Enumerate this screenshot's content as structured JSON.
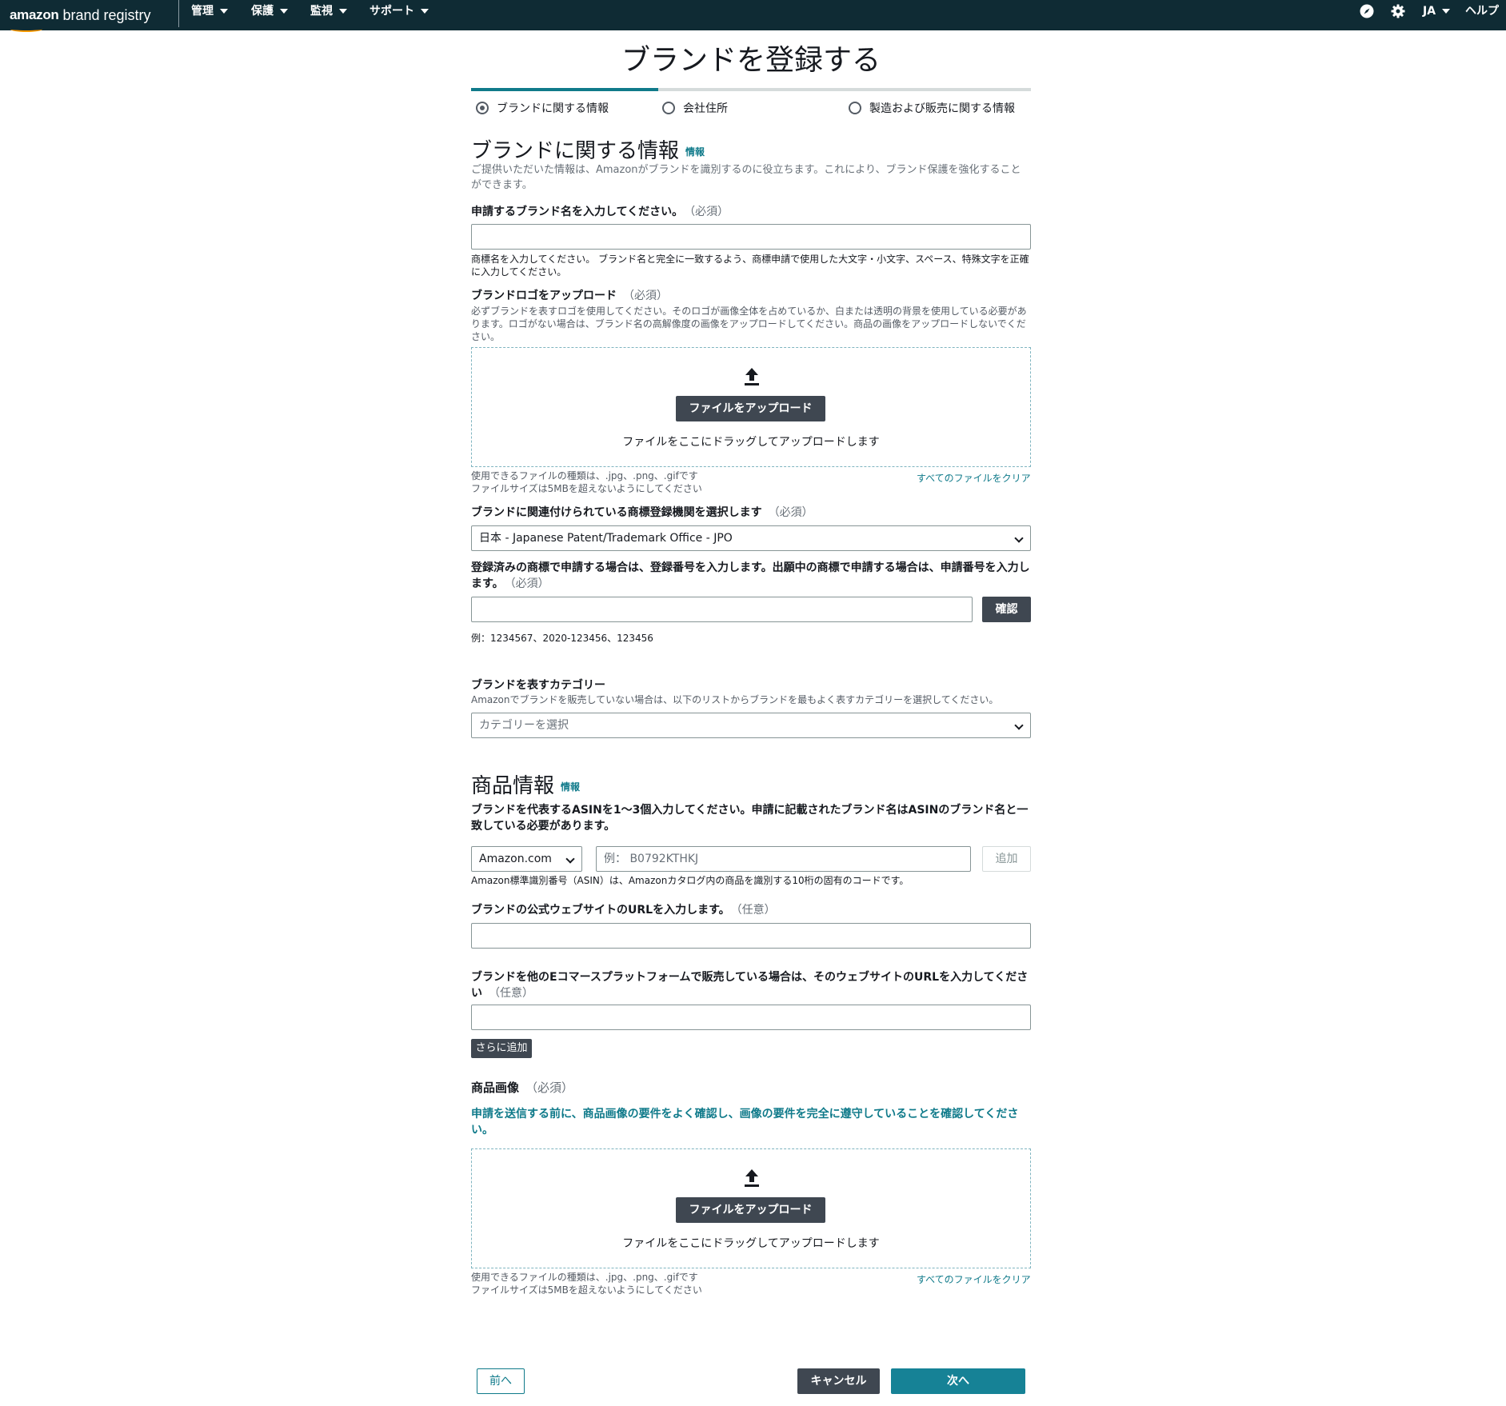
{
  "nav": {
    "logo_amazon": "amazon",
    "logo_rest": "brand registry",
    "menus": [
      "管理",
      "保護",
      "監視",
      "サポート"
    ],
    "icons": [
      "compass-icon",
      "gear-icon"
    ],
    "language": "JA",
    "help": "ヘルプ",
    "background": "#0f2b34"
  },
  "page": {
    "title": "ブランドを登録する",
    "steps": [
      "ブランドに関する情報",
      "会社住所",
      "製造および販売に関する情報"
    ],
    "active_step": 0,
    "accent_color": "#0f7a8a"
  },
  "brand_section": {
    "heading": "ブランドに関する情報",
    "info_link": "情報",
    "description": "ご提供いただいた情報は、Amazonがブランドを識別するのに役立ちます。これにより、ブランド保護を強化することができます。",
    "brand_name_label": "申請するブランド名を入力してください。",
    "brand_name_required": "（必須）",
    "brand_name_value": "",
    "brand_name_help": "商標名を入力してください。 ブランド名と完全に一致するよう、商標申請で使用した大文字・小文字、スペース、特殊文字を正確に入力してください。",
    "logo_label": "ブランドロゴをアップロード",
    "logo_required": "（必須）",
    "logo_help": "必ずブランドを表すロゴを使用してください。そのロゴが画像全体を占めているか、白または透明の背景を使用している必要があります。ロゴがない場合は、ブランド名の高解像度の画像をアップロードしてください。商品の画像をアップロードしないでください。",
    "upload_button": "ファイルをアップロード",
    "drop_text": "ファイルをここにドラッグしてアップロードします",
    "file_types": "使用できるファイルの種類は、.jpg、.png、.gifです",
    "file_size": "ファイルサイズは5MBを超えないようにしてください",
    "clear_all": "すべてのファイルをクリア",
    "office_label": "ブランドに関連付けられている商標登録機関を選択します",
    "office_required": "（必須）",
    "office_value": "日本 - Japanese Patent/Trademark Office - JPO",
    "reg_label": "登録済みの商標で申請する場合は、登録番号を入力します。出願中の商標で申請する場合は、申請番号を入力します。",
    "reg_required": "（必須）",
    "reg_value": "",
    "verify_button": "確認",
    "reg_example": "例：1234567、2020-123456、123456",
    "category_label": "ブランドを表すカテゴリー",
    "category_help": "Amazonでブランドを販売していない場合は、以下のリストからブランドを最もよく表すカテゴリーを選択してください。",
    "category_placeholder": "カテゴリーを選択"
  },
  "product_section": {
    "heading": "商品情報",
    "info_link": "情報",
    "asin_label": "ブランドを代表するASINを1〜3個入力してください。申請に記載されたブランド名はASINのブランド名と一致している必要があります。",
    "marketplace_value": "Amazon.com",
    "asin_placeholder": "例： B0792KTHKJ",
    "add_button": "追加",
    "asin_help": "Amazon標準識別番号（ASIN）は、Amazonカタログ内の商品を識別する10桁の固有のコードです。",
    "website_label": "ブランドの公式ウェブサイトのURLを入力します。",
    "website_optional": "（任意）",
    "website_value": "",
    "ecommerce_label": "ブランドを他のEコマースプラットフォームで販売している場合は、そのウェブサイトのURLを入力してください",
    "ecommerce_optional": "（任意）",
    "ecommerce_value": "",
    "add_more_button": "さらに追加",
    "images_label": "商品画像",
    "images_required": "（必須）",
    "images_warning": "申請を送信する前に、商品画像の要件をよく確認し、画像の要件を完全に遵守していることを確認してください。",
    "upload_button": "ファイルをアップロード",
    "drop_text": "ファイルをここにドラッグしてアップロードします",
    "file_types": "使用できるファイルの種類は、.jpg、.png、.gifです",
    "file_size": "ファイルサイズは5MBを超えないようにしてください",
    "clear_all": "すべてのファイルをクリア"
  },
  "footer": {
    "prev_button": "前へ",
    "cancel_button": "キャンセル",
    "next_button": "次へ"
  }
}
